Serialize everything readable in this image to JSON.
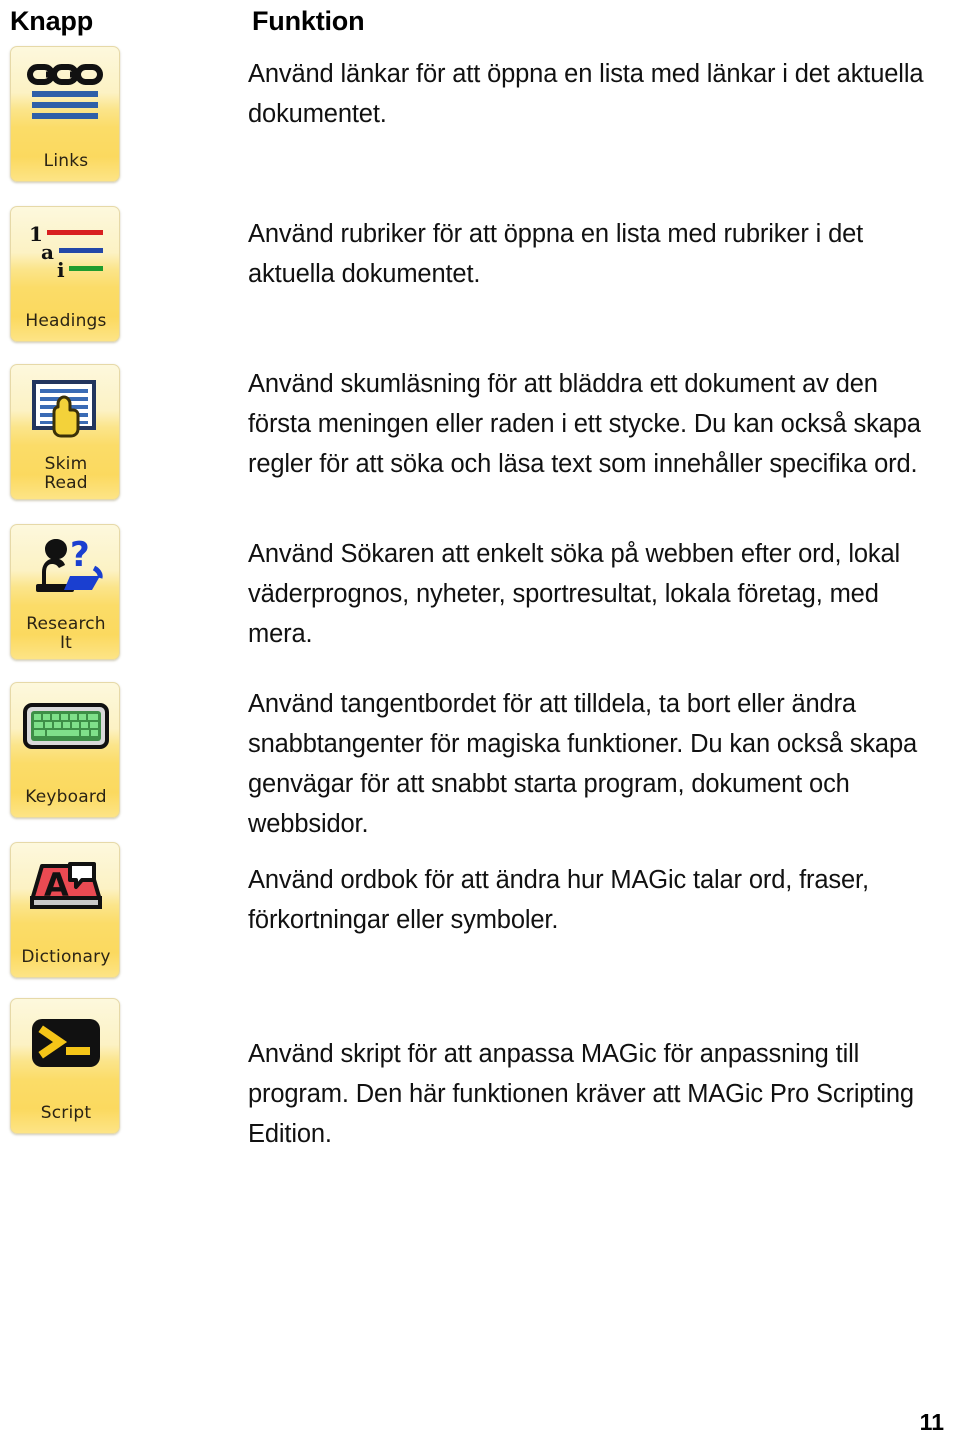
{
  "page": {
    "number": "11"
  },
  "table": {
    "headers": {
      "button": "Knapp",
      "function": "Funktion"
    },
    "rows": [
      {
        "icon": "links-icon",
        "button_label": "Links",
        "description": "Använd länkar för att öppna en lista med länkar i det aktuella dokumentet."
      },
      {
        "icon": "headings-icon",
        "button_label": "Headings",
        "description": "Använd rubriker för att öppna en lista med rubriker i det aktuella dokumentet."
      },
      {
        "icon": "skim-read-icon",
        "button_label": "Skim\nRead",
        "description": "Använd skumläsning för att bläddra ett dokument av den första meningen eller raden i ett stycke. Du kan också skapa regler för att söka och läsa text som innehåller specifika ord."
      },
      {
        "icon": "research-it-icon",
        "button_label": "Research\nIt",
        "description": "Använd Sökaren att enkelt söka på webben efter ord, lokal väderprognos, nyheter, sportresultat, lokala företag, med mera."
      },
      {
        "icon": "keyboard-icon",
        "button_label": "Keyboard",
        "description": "Använd tangentbordet för att tilldela, ta bort eller ändra snabbtangenter för magiska funktioner. Du kan också skapa genvägar för att snabbt starta program, dokument och webbsidor."
      },
      {
        "icon": "dictionary-icon",
        "button_label": "Dictionary",
        "description": "Använd ordbok för att ändra hur MAGic talar ord, fraser, förkortningar eller symboler."
      },
      {
        "icon": "script-icon",
        "button_label": "Script",
        "description": "Använd skript för att anpassa MAGic för anpassning till  program. Den här funktionen kräver att MAGic Pro Scripting Edition."
      }
    ]
  },
  "colors": {
    "button_top": "#fdf8dd",
    "button_bottom": "#fbd95f",
    "button_border": "#e6d9a8",
    "links_bar": "#2f5fa8",
    "heading_rule_1": "#d82020",
    "heading_rule_2": "#2448a8",
    "heading_rule_3": "#1f9c2f",
    "keyboard_key": "#7fe08a",
    "dictionary_book": "#ea4a52",
    "research_accent": "#1a3fd0",
    "script_prompt": "#f5c518",
    "text": "#111111"
  }
}
